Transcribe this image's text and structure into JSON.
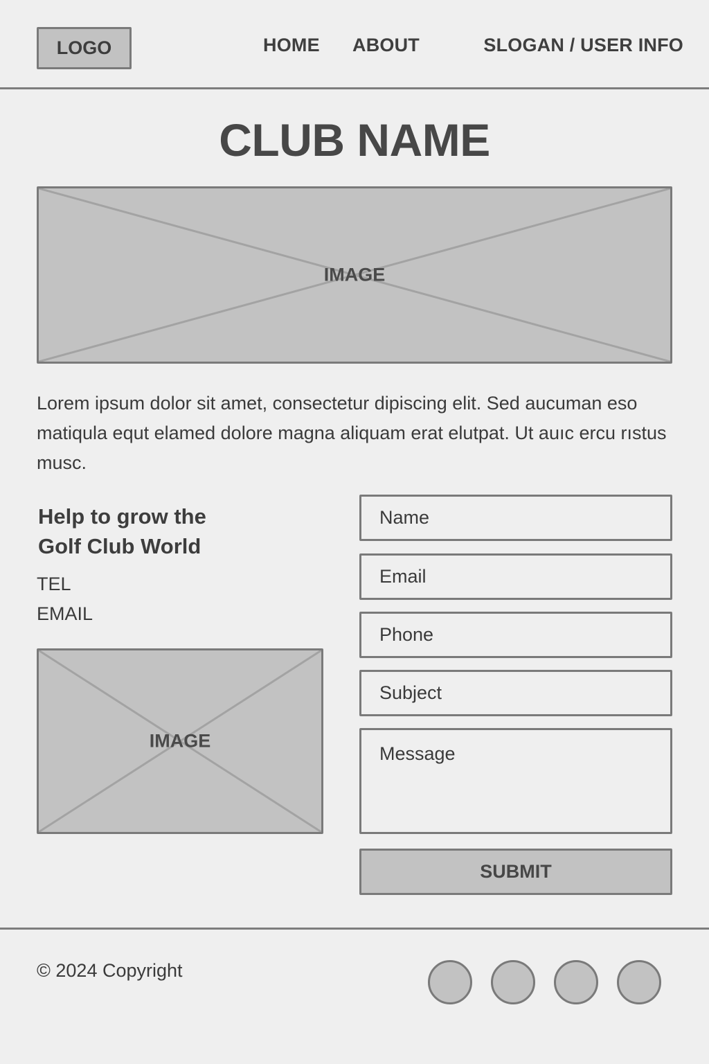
{
  "header": {
    "logo_label": "LOGO",
    "nav": [
      {
        "label": "HOME"
      },
      {
        "label": "ABOUT"
      }
    ],
    "slogan": "SLOGAN / USER INFO"
  },
  "main": {
    "title": "CLUB NAME",
    "hero_image_label": "IMAGE",
    "intro": "Lorem ipsum dolor sit amet, consectetur  dipiscing elit. Sed aucuman eso matiqula equt elamed dolore magna aliquam erat elutpat. Ut auıc ercu rıstus musc.",
    "contact": {
      "heading_line1": "Help to grow the",
      "heading_line2": "Golf Club World",
      "tel_label": "TEL",
      "email_label": "EMAIL",
      "image_label": "IMAGE"
    },
    "form": {
      "name_placeholder": "Name",
      "email_placeholder": "Email",
      "phone_placeholder": "Phone",
      "subject_placeholder": "Subject",
      "message_placeholder": "Message",
      "submit_label": "SUBMIT"
    }
  },
  "footer": {
    "copyright": "© 2024 Copyright",
    "social_icons": [
      "social-icon-1",
      "social-icon-2",
      "social-icon-3",
      "social-icon-4"
    ]
  },
  "colors": {
    "background": "#efefef",
    "placeholder_fill": "#c2c2c2",
    "border": "#7a7a7a",
    "text": "#3f3f3f"
  }
}
